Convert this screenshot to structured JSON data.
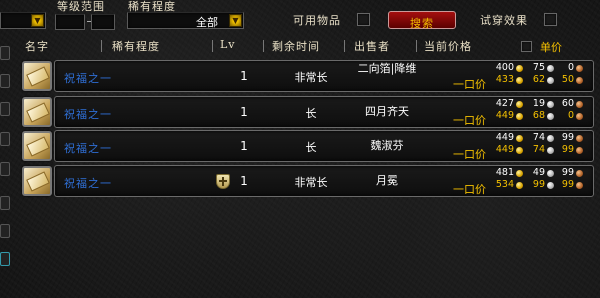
{
  "filters": {
    "level_range_label": "等级范围",
    "rarity_label": "稀有程度",
    "rarity_value": "全部",
    "usable_label": "可用物品",
    "search_button": "搜索",
    "try_on_label": "试穿效果"
  },
  "columns": {
    "name": "名字",
    "rarity": "稀有程度",
    "level": "Lv",
    "time_left": "剩余时间",
    "seller": "出售者",
    "current_price": "当前价格",
    "unit_price": "单价"
  },
  "buyout_label": "一口价",
  "rows": [
    {
      "name": "祝福之一",
      "level": "1",
      "time_left": "非常长",
      "seller": "二向箔|降维",
      "has_shield": false,
      "bid": {
        "gold": "400",
        "silver": "75",
        "copper": "0"
      },
      "buyout": {
        "gold": "433",
        "silver": "62",
        "copper": "50"
      }
    },
    {
      "name": "祝福之一",
      "level": "1",
      "time_left": "长",
      "seller": "四月齐天",
      "has_shield": false,
      "bid": {
        "gold": "427",
        "silver": "19",
        "copper": "60"
      },
      "buyout": {
        "gold": "449",
        "silver": "68",
        "copper": "0"
      }
    },
    {
      "name": "祝福之一",
      "level": "1",
      "time_left": "长",
      "seller": "魏淑芬",
      "has_shield": false,
      "bid": {
        "gold": "449",
        "silver": "74",
        "copper": "99"
      },
      "buyout": {
        "gold": "449",
        "silver": "74",
        "copper": "99"
      }
    },
    {
      "name": "祝福之一",
      "level": "1",
      "time_left": "非常长",
      "seller": "月冕",
      "has_shield": true,
      "bid": {
        "gold": "481",
        "silver": "49",
        "copper": "99"
      },
      "buyout": {
        "gold": "534",
        "silver": "99",
        "copper": "99"
      }
    }
  ],
  "icons": {
    "item": "scroll-item-icon",
    "dropdown": "dropdown-arrow-icon",
    "shield": "shield-icon"
  }
}
